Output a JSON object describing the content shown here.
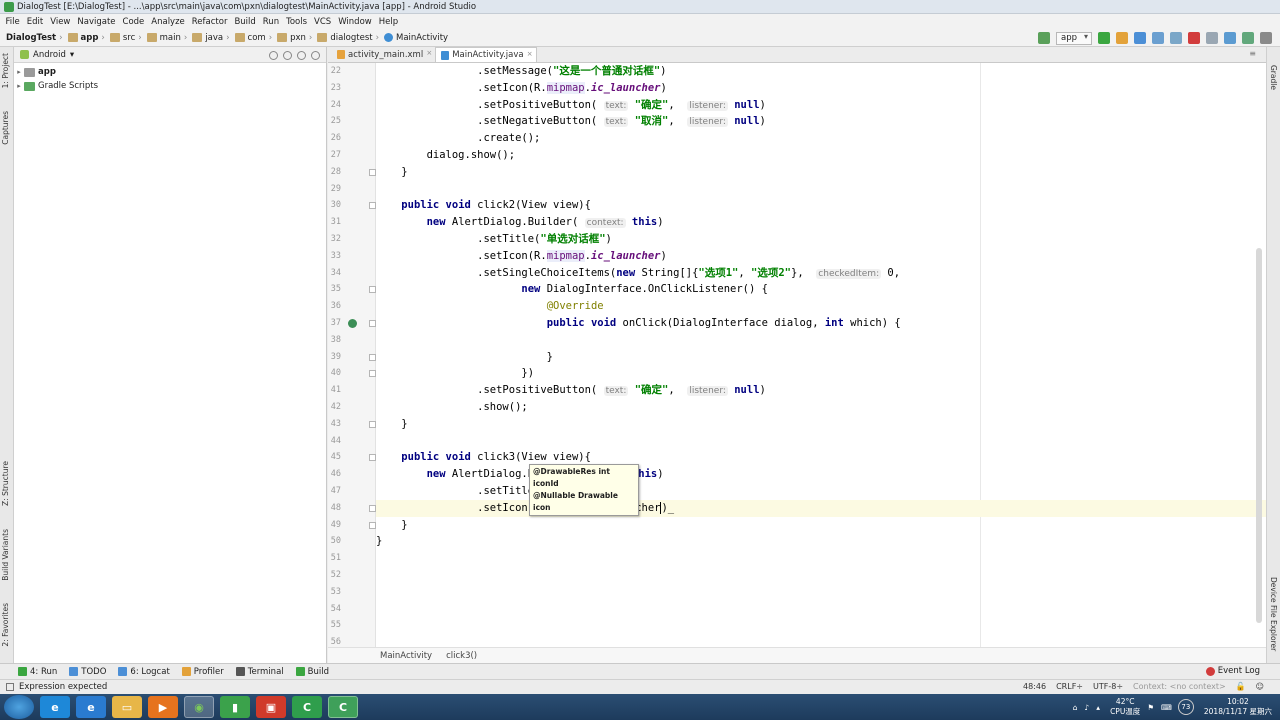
{
  "title_bar": {
    "text": "DialogTest [E:\\DialogTest] - ...\\app\\src\\main\\java\\com\\pxn\\dialogtest\\MainActivity.java [app] - Android Studio"
  },
  "menu": [
    "File",
    "Edit",
    "View",
    "Navigate",
    "Code",
    "Analyze",
    "Refactor",
    "Build",
    "Run",
    "Tools",
    "VCS",
    "Window",
    "Help"
  ],
  "nav_breadcrumb": [
    "DialogTest",
    "app",
    "src",
    "main",
    "java",
    "com",
    "pxn",
    "dialogtest",
    "MainActivity"
  ],
  "run_config": "app",
  "left_tool_tabs": [
    "1: Project",
    "Captures",
    "Z: Structure",
    "Build Variants",
    "2: Favorites"
  ],
  "right_tool_tabs": [
    "Gradle",
    "Device File Explorer"
  ],
  "project_panel": {
    "view_mode": "Android",
    "tree": [
      {
        "label": "app",
        "bold": true
      },
      {
        "label": "Gradle Scripts",
        "bold": false
      }
    ]
  },
  "editor_tabs": [
    {
      "label": "activity_main.xml",
      "active": false
    },
    {
      "label": "MainActivity.java",
      "active": true
    }
  ],
  "code_lines": [
    {
      "n": "22",
      "t": [
        [
          "",
          "                .setMessage("
        ],
        [
          "str",
          "\"这是一个普通对话框\""
        ],
        [
          "",
          ")"
        ]
      ]
    },
    {
      "n": "23",
      "t": [
        [
          "",
          "                .setIcon(R."
        ],
        [
          "field",
          "mipmap"
        ],
        [
          "",
          "."
        ],
        [
          "ital",
          "ic_launcher"
        ],
        [
          "",
          ")"
        ]
      ]
    },
    {
      "n": "24",
      "t": [
        [
          "",
          "                .setPositiveButton( "
        ],
        [
          "hint",
          "text:"
        ],
        [
          "",
          " "
        ],
        [
          "str",
          "\"确定\""
        ],
        [
          "",
          ",  "
        ],
        [
          "hint",
          "listener:"
        ],
        [
          "",
          " "
        ],
        [
          "kw",
          "null"
        ],
        [
          "",
          ")"
        ]
      ]
    },
    {
      "n": "25",
      "t": [
        [
          "",
          "                .setNegativeButton( "
        ],
        [
          "hint",
          "text:"
        ],
        [
          "",
          " "
        ],
        [
          "str",
          "\"取消\""
        ],
        [
          "",
          ",  "
        ],
        [
          "hint",
          "listener:"
        ],
        [
          "",
          " "
        ],
        [
          "kw",
          "null"
        ],
        [
          "",
          ")"
        ]
      ]
    },
    {
      "n": "26",
      "t": [
        [
          "",
          "                .create();"
        ]
      ]
    },
    {
      "n": "27",
      "t": [
        [
          "",
          "        dialog.show();"
        ]
      ]
    },
    {
      "n": "28",
      "t": [
        [
          "",
          "    }"
        ]
      ]
    },
    {
      "n": "29",
      "t": [
        [
          "",
          ""
        ]
      ]
    },
    {
      "n": "30",
      "t": [
        [
          "",
          "    "
        ],
        [
          "kw",
          "public void"
        ],
        [
          "",
          " click2(View view){"
        ]
      ]
    },
    {
      "n": "31",
      "t": [
        [
          "",
          "        "
        ],
        [
          "kw",
          "new"
        ],
        [
          "",
          " AlertDialog.Builder( "
        ],
        [
          "hint",
          "context:"
        ],
        [
          "",
          " "
        ],
        [
          "kw",
          "this"
        ],
        [
          "",
          ")"
        ]
      ]
    },
    {
      "n": "32",
      "t": [
        [
          "",
          "                .setTitle("
        ],
        [
          "str",
          "\"单选对话框\""
        ],
        [
          "",
          ")"
        ]
      ]
    },
    {
      "n": "33",
      "t": [
        [
          "",
          "                .setIcon(R."
        ],
        [
          "field",
          "mipmap"
        ],
        [
          "",
          "."
        ],
        [
          "ital",
          "ic_launcher"
        ],
        [
          "",
          ")"
        ]
      ]
    },
    {
      "n": "34",
      "t": [
        [
          "",
          "                .setSingleChoiceItems("
        ],
        [
          "kw",
          "new"
        ],
        [
          "",
          " String[]{"
        ],
        [
          "str",
          "\"选项1\""
        ],
        [
          "",
          ", "
        ],
        [
          "str",
          "\"选项2\""
        ],
        [
          "",
          "},  "
        ],
        [
          "hint",
          "checkedItem:"
        ],
        [
          "",
          " 0,"
        ]
      ]
    },
    {
      "n": "35",
      "t": [
        [
          "",
          "                       "
        ],
        [
          "kw",
          "new"
        ],
        [
          "",
          " DialogInterface.OnClickListener() {"
        ]
      ]
    },
    {
      "n": "36",
      "t": [
        [
          "",
          "                           "
        ],
        [
          "anno",
          "@Override"
        ]
      ]
    },
    {
      "n": "37",
      "t": [
        [
          "",
          "                           "
        ],
        [
          "kw",
          "public void"
        ],
        [
          "",
          " onClick(DialogInterface dialog, "
        ],
        [
          "kw",
          "int"
        ],
        [
          "",
          " which) {"
        ]
      ]
    },
    {
      "n": "38",
      "t": [
        [
          "",
          ""
        ]
      ]
    },
    {
      "n": "39",
      "t": [
        [
          "",
          "                           }"
        ]
      ]
    },
    {
      "n": "40",
      "t": [
        [
          "",
          "                       })"
        ]
      ]
    },
    {
      "n": "41",
      "t": [
        [
          "",
          "                .setPositiveButton( "
        ],
        [
          "hint",
          "text:"
        ],
        [
          "",
          " "
        ],
        [
          "str",
          "\"确定\""
        ],
        [
          "",
          ",  "
        ],
        [
          "hint",
          "listener:"
        ],
        [
          "",
          " "
        ],
        [
          "kw",
          "null"
        ],
        [
          "",
          ")"
        ]
      ]
    },
    {
      "n": "42",
      "t": [
        [
          "",
          "                .show();"
        ]
      ]
    },
    {
      "n": "43",
      "t": [
        [
          "",
          "    }"
        ]
      ]
    },
    {
      "n": "44",
      "t": [
        [
          "",
          ""
        ]
      ]
    },
    {
      "n": "45",
      "t": [
        [
          "",
          "    "
        ],
        [
          "kw",
          "public void"
        ],
        [
          "",
          " click3(View view){"
        ]
      ]
    },
    {
      "n": "46",
      "t": [
        [
          "",
          "        "
        ],
        [
          "kw",
          "new"
        ],
        [
          "",
          " AlertDialog.Builder( "
        ],
        [
          "hint",
          "context:"
        ],
        [
          "",
          " "
        ],
        [
          "kw",
          "this"
        ],
        [
          "",
          ")"
        ]
      ]
    },
    {
      "n": "47",
      "t": [
        [
          "",
          "                .setTitle("
        ],
        [
          "str",
          "\"多选对话框\""
        ],
        [
          "",
          ")"
        ]
      ]
    },
    {
      "n": "48",
      "t": [
        [
          "",
          "                .setIcon(R."
        ],
        [
          "field",
          "mipmap"
        ],
        [
          "",
          ".ic_launcher"
        ],
        [
          "caret",
          ""
        ],
        [
          "",
          ")_"
        ]
      ],
      "current": true
    },
    {
      "n": "49",
      "t": [
        [
          "",
          "    }"
        ]
      ]
    },
    {
      "n": "50",
      "t": [
        [
          "",
          "}"
        ]
      ]
    },
    {
      "n": "51",
      "t": [
        [
          "",
          ""
        ]
      ]
    },
    {
      "n": "52",
      "t": [
        [
          "",
          ""
        ]
      ]
    },
    {
      "n": "53",
      "t": [
        [
          "",
          ""
        ]
      ]
    },
    {
      "n": "54",
      "t": [
        [
          "",
          ""
        ]
      ]
    },
    {
      "n": "55",
      "t": [
        [
          "",
          ""
        ]
      ]
    },
    {
      "n": "56",
      "t": [
        [
          "",
          ""
        ]
      ]
    }
  ],
  "param_tooltip": [
    "@DrawableRes int iconId",
    "@Nullable Drawable icon"
  ],
  "editor_breadcrumb": [
    "MainActivity",
    "click3()"
  ],
  "tool_windows": [
    "4: Run",
    "TODO",
    "6: Logcat",
    "Profiler",
    "Terminal",
    "Build"
  ],
  "event_log": "Event Log",
  "status": {
    "message": "Expression expected",
    "position": "48:46",
    "line_sep": "CRLF÷",
    "encoding": "UTF-8÷",
    "context": "Context: <no context>"
  },
  "taskbar": {
    "temp": "42°C",
    "cpu_label": "CPU温度",
    "badge": "73",
    "time": "10:02",
    "date": "2018/11/17 星期六"
  },
  "colors": {
    "keyword": "#000080",
    "string": "#008000",
    "field": "#660e7a",
    "annotation": "#808000"
  }
}
